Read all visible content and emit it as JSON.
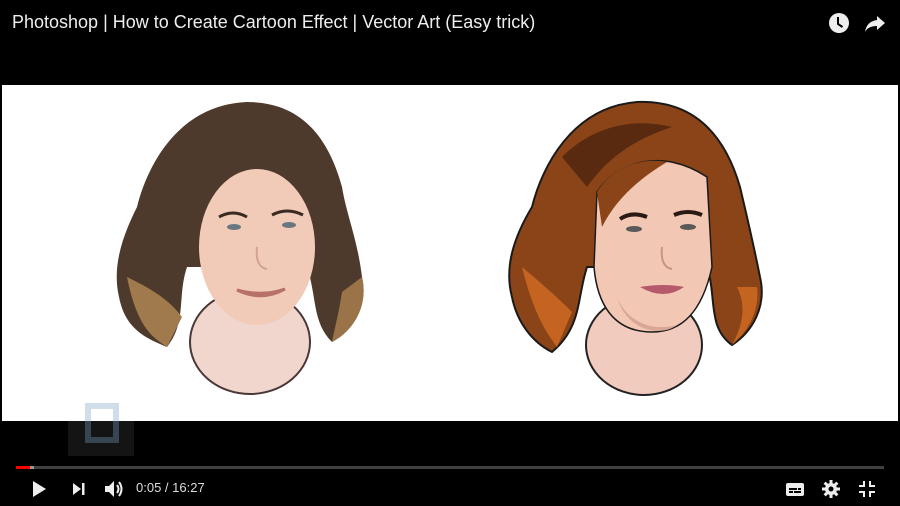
{
  "video": {
    "title": "Photoshop | How to Create Cartoon Effect | Vector Art (Easy trick)",
    "top_icons": [
      "watch-later-icon",
      "share-icon"
    ]
  },
  "player": {
    "current_time": "0:05",
    "duration": "16:27",
    "time_separator": " / ",
    "time_display": "0:05 / 16:27",
    "played_fraction": 0.005,
    "buffered_fraction": 0.021,
    "progress_color": "#ff0000",
    "controls_left": [
      "play-icon",
      "next-icon",
      "volume-icon"
    ],
    "controls_right": [
      "subtitles-icon",
      "settings-icon",
      "exit-fullscreen-icon"
    ]
  },
  "frame": {
    "left_portrait": "photo of woman with wavy brown hair",
    "right_portrait": "cartoon vector art version of the same woman"
  }
}
